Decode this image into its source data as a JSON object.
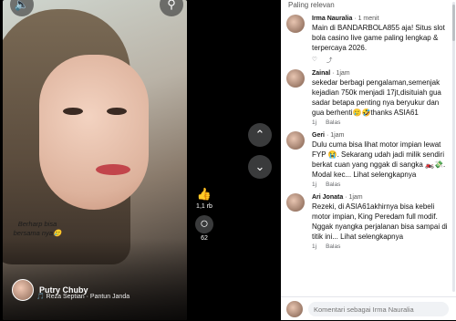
{
  "video": {
    "caption": "Berharp bisa bersama nya🥲",
    "author": "Putry Chuby",
    "music": "🎵 Reza Septian · Pantun Janda",
    "likes": "1,1 rb",
    "comments_count": "62"
  },
  "panel": {
    "sort_label": "Paling relevan",
    "composer_placeholder": "Komentari sebagai Irma Nauralia"
  },
  "comments": [
    {
      "name": "Irma Nauralia",
      "time": "1 menit",
      "text": "Main di BANDARBOLA855 aja! Situs slot bola casino live game paling lengkap & terpercaya 2026.",
      "actions": [
        "♡",
        "⤴"
      ]
    },
    {
      "name": "Zainal",
      "time": "1jam",
      "text": "sekedar berbagi pengalaman,semenjak kejadian 750k menjadi 17jt,disituiah gua sadar betapa penting nya beryukur dan gua berhenti🥲🤣thanks ASIA61",
      "actions": [
        "1j",
        "Balas"
      ]
    },
    {
      "name": "Geri",
      "time": "1jam",
      "text": "Dulu cuma bisa lihat motor impian lewat FYP 😭. Sekarang udah jadi milik sendiri berkat cuan yang nggak di sangka 🏍️💸. Modal kec... Lihat selengkapnya",
      "actions": [
        "1j",
        "Balas"
      ]
    },
    {
      "name": "Ari Jonata",
      "time": "1jam",
      "text": "Rezeki, di ASIA61akhirnya bisa kebeli motor impian, King Peredam full modif. Nggak nyangka perjalanan bisa sampai di titik ini... Lihat selengkapnya",
      "actions": [
        "1j",
        "Balas"
      ]
    }
  ]
}
